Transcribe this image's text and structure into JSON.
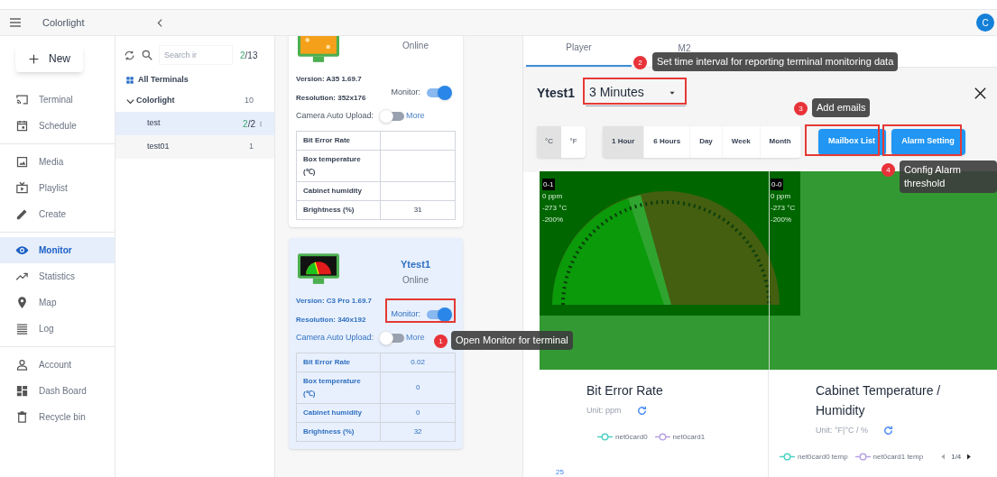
{
  "app_bar": {
    "title": "Colorlight",
    "avatar": "C"
  },
  "new_button": "New",
  "nav_sections": [
    [
      {
        "label": "Terminal",
        "selected": false
      },
      {
        "label": "Schedule",
        "selected": false
      }
    ],
    [
      {
        "label": "Media",
        "selected": false
      },
      {
        "label": "Playlist",
        "selected": false
      },
      {
        "label": "Create",
        "selected": false
      }
    ],
    [
      {
        "label": "Monitor",
        "selected": true
      },
      {
        "label": "Statistics",
        "selected": false
      },
      {
        "label": "Map",
        "selected": false
      },
      {
        "label": "Log",
        "selected": false
      }
    ],
    [
      {
        "label": "Account",
        "selected": false
      },
      {
        "label": "Dash Board",
        "selected": false
      },
      {
        "label": "Recycle bin",
        "selected": false
      }
    ]
  ],
  "terminal_list": {
    "search_placeholder": "Search ir",
    "online": "2",
    "total": "/13",
    "all_label": "All Terminals",
    "groups": [
      {
        "name": "Colorlight",
        "count": "10",
        "expanded": true,
        "children": [
          {
            "name": "test",
            "online": "2",
            "total": "/2",
            "selected": true
          },
          {
            "name": "test01",
            "count": "1",
            "selected": false
          }
        ]
      }
    ]
  },
  "terminal_cards": [
    {
      "status": "Online",
      "version_label": "Version:",
      "version": "A35 1.69.7",
      "resolution_label": "Resolution:",
      "resolution": "352x176",
      "monitor_label": "Monitor:",
      "monitor": true,
      "camera_label": "Camera Auto Upload:",
      "camera_auto_upload": false,
      "more": "More",
      "selected": false,
      "metrics": [
        {
          "label": "Bit Error Rate"
        },
        {
          "label": "Box temperature (℃)"
        },
        {
          "label": "Cabinet humidity"
        },
        {
          "label": "Brightness  (%)",
          "value": "31"
        }
      ]
    },
    {
      "name": "Ytest1",
      "status": "Online",
      "version_label": "Version:",
      "version": "C3 Pro 1.69.7",
      "resolution_label": "Resolution:",
      "resolution": "340x192",
      "monitor_label": "Monitor:",
      "monitor": true,
      "camera_label": "Camera Auto Upload:",
      "camera_auto_upload": false,
      "more": "More",
      "selected": true,
      "metrics": [
        {
          "label": "Bit Error Rate",
          "value": "0.02"
        },
        {
          "label": "Box temperature (℃)",
          "value": "0"
        },
        {
          "label": "Cabinet humidity",
          "value": "0"
        },
        {
          "label": "Brightness  (%)",
          "value": "32"
        }
      ]
    }
  ],
  "detail": {
    "tabs": [
      {
        "label": "Player",
        "selected": true
      },
      {
        "label": "M2",
        "selected": false
      }
    ],
    "title": "Ytest1",
    "interval": "3 Minutes",
    "units": [
      {
        "label": "°C",
        "selected": true
      },
      {
        "label": "°F",
        "selected": false
      }
    ],
    "ranges": [
      {
        "label": "1 Hour",
        "selected": true
      },
      {
        "label": "6 Hours",
        "selected": false
      },
      {
        "label": "Day",
        "selected": false
      },
      {
        "label": "Week",
        "selected": false
      },
      {
        "label": "Month",
        "selected": false
      }
    ],
    "buttons": [
      "Mailbox List",
      "Alarm Setting"
    ],
    "preview_overlays": [
      {
        "tag": "0-1",
        "lines": [
          "0 ppm",
          "-273 °C",
          "-200%"
        ]
      },
      {
        "tag": "0-0",
        "lines": [
          "0 ppm",
          "-273 °C",
          "-200%"
        ]
      }
    ],
    "charts": [
      {
        "title": "Bit Error Rate",
        "unit": "Unit: ppm",
        "legend": [
          {
            "name": "net0card0",
            "color": "#4fd1c5"
          },
          {
            "name": "net0card1",
            "color": "#b9a3e3"
          }
        ],
        "y_tick": "25"
      },
      {
        "title": "Cabinet Temperature / Humidity",
        "unit": "Unit:  °F|°C / %",
        "legend": [
          {
            "name": "net0card0 temp",
            "color": "#4fd1c5"
          },
          {
            "name": "net0card1 temp",
            "color": "#b9a3e3"
          }
        ],
        "pager": "1/4"
      }
    ]
  },
  "annotations": [
    {
      "number": "1",
      "text": "Open Monitor for terminal"
    },
    {
      "number": "2",
      "text": "Set time interval for reporting terminal monitoring data"
    },
    {
      "number": "3",
      "text": "Add emails"
    },
    {
      "number": "4",
      "text": "Config Alarm threshold"
    }
  ]
}
